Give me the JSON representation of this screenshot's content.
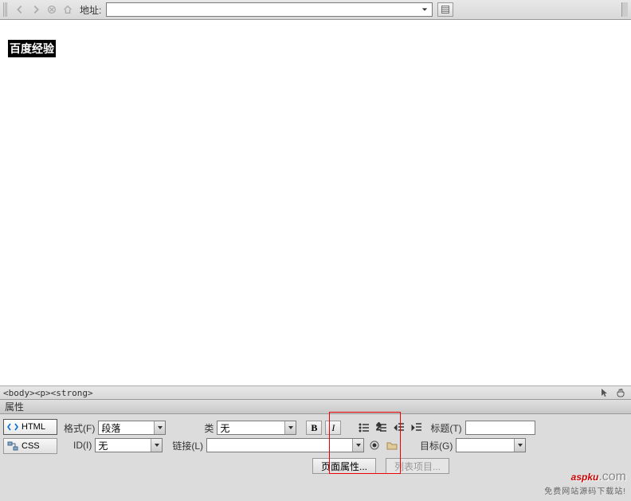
{
  "toolbar": {
    "address_label": "地址:",
    "address_value": ""
  },
  "content": {
    "selected_text": "百度经验"
  },
  "breadcrumb": {
    "path": "<body><p><strong>"
  },
  "properties": {
    "header": "属性",
    "modes": {
      "html": "HTML",
      "css": "CSS"
    },
    "labels": {
      "format": "格式(F)",
      "id": "ID(I)",
      "class": "类",
      "link": "链接(L)",
      "title": "标题(T)",
      "target": "目标(G)"
    },
    "values": {
      "format": "段落",
      "id": "无",
      "class": "无",
      "link": "",
      "title": "",
      "target": ""
    },
    "format_buttons": {
      "bold": "B",
      "italic": "I"
    },
    "page_buttons": {
      "page_props": "页面属性...",
      "list_items": "列表项目..."
    }
  },
  "watermark": {
    "brand": "aspku",
    "suffix": ".com",
    "tagline": "免费网站源码下载站!"
  }
}
